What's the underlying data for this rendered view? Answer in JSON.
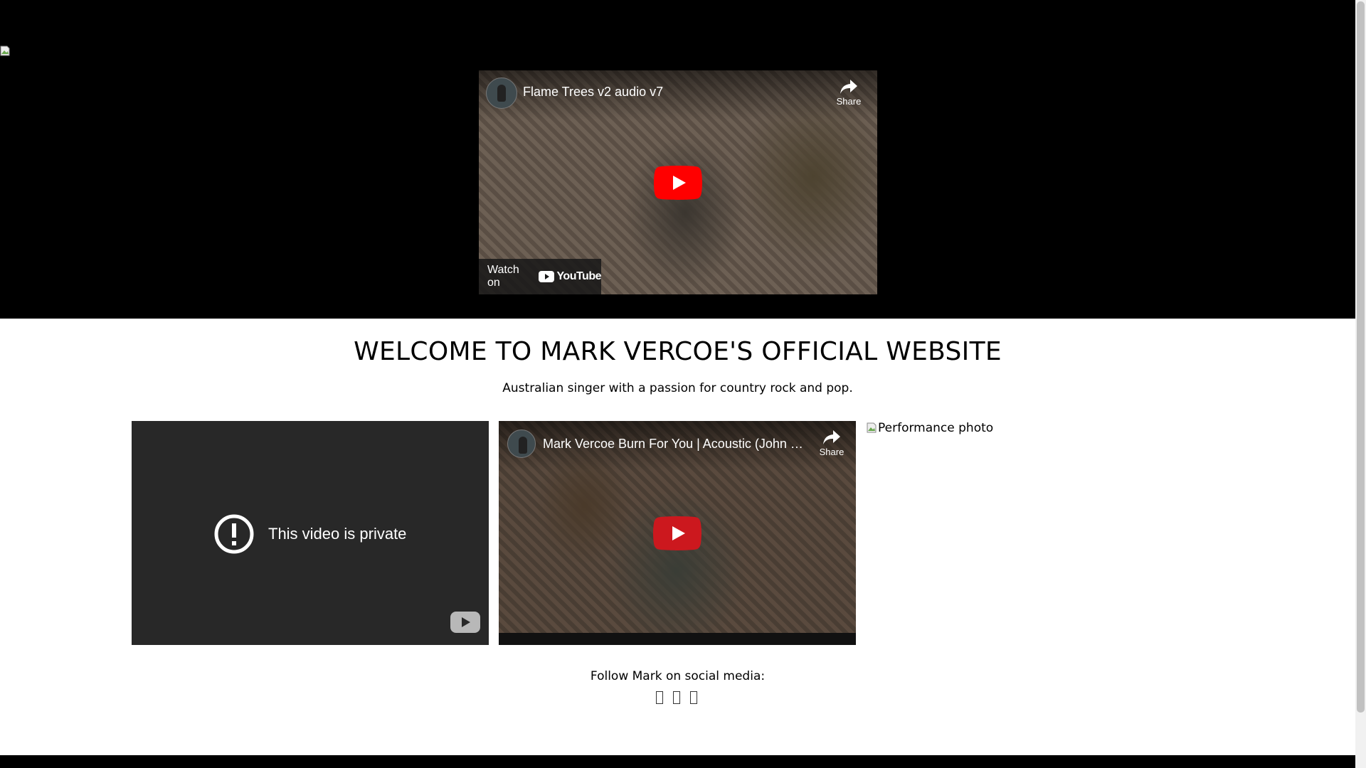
{
  "hero_video": {
    "title": "Flame Trees v2 audio v7",
    "share_label": "Share",
    "watch_on_label": "Watch on",
    "youtube_label": "YouTube"
  },
  "main": {
    "headline": "WELCOME TO MARK VERCOE'S OFFICIAL WEBSITE",
    "tagline": "Australian singer with a passion for country rock and pop."
  },
  "videos": {
    "private_message": "This video is private",
    "burn_title": "Mark Vercoe Burn For You | Acoustic (John …",
    "burn_share_label": "Share"
  },
  "performance_photo": {
    "alt": "Performance photo"
  },
  "social": {
    "label": "Follow Mark on social media:",
    "icons": [
      "facebook-icon",
      "instagram-icon",
      "youtube-icon"
    ]
  },
  "colors": {
    "header_bg": "#000000",
    "page_bg": "#ffffff",
    "yt_red": "#ff0000",
    "private_bg": "#282828"
  }
}
